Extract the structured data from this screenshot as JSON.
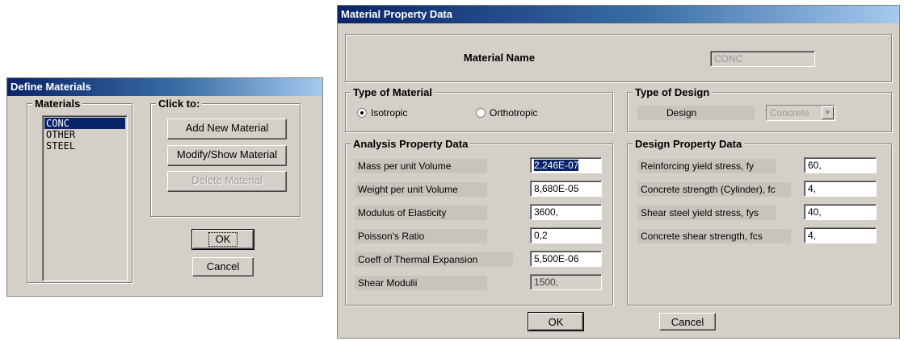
{
  "define_materials": {
    "title": "Define Materials",
    "materials_label": "Materials",
    "materials": [
      "CONC",
      "OTHER",
      "STEEL"
    ],
    "click_to_label": "Click to:",
    "add_label": "Add New Material",
    "modify_label": "Modify/Show Material",
    "delete_label": "Delete Material",
    "ok_label": "OK",
    "cancel_label": "Cancel"
  },
  "material_property": {
    "title": "Material Property Data",
    "name_label": "Material Name",
    "name_value": "CONC",
    "type_label": "Type of Material",
    "isotropic_label": "Isotropic",
    "orthotropic_label": "Orthotropic",
    "selected_type": "Isotropic",
    "design_type_label": "Type of Design",
    "design_label": "Design",
    "design_value": "Concrete",
    "analysis_label": "Analysis Property Data",
    "mass_label": "Mass per unit Volume",
    "mass_value": "2,246E-07",
    "weight_label": "Weight per unit Volume",
    "weight_value": "8,680E-05",
    "elasticity_label": "Modulus of Elasticity",
    "elasticity_value": "3600,",
    "poisson_label": "Poisson's Ratio",
    "poisson_value": "0,2",
    "thermal_label": "Coeff of Thermal Expansion",
    "thermal_value": "5,500E-06",
    "shear_label": "Shear Modulii",
    "shear_value": "1500,",
    "design_prop_label": "Design Property Data",
    "fy_label": "Reinforcing yield stress, fy",
    "fy_value": "60,",
    "fc_label": "Concrete strength (Cylinder), fc",
    "fc_value": "4,",
    "fys_label": "Shear steel yield stress, fys",
    "fys_value": "40,",
    "fcs_label": "Concrete shear strength, fcs",
    "fcs_value": "4,",
    "ok_label": "OK",
    "cancel_label": "Cancel"
  }
}
